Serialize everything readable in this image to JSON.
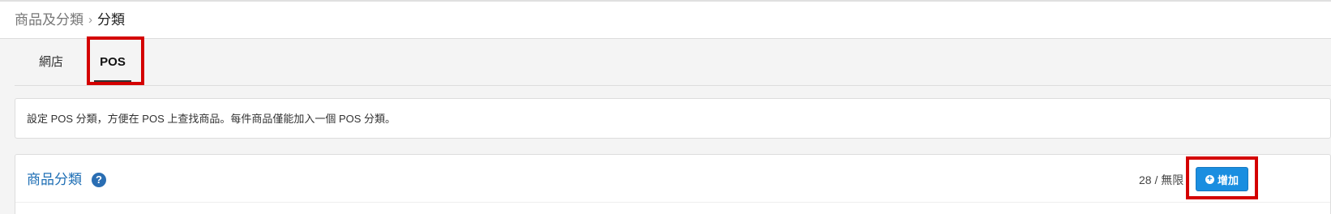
{
  "breadcrumb": {
    "parent": "商品及分類",
    "separator": "›",
    "current": "分類"
  },
  "tabs": [
    {
      "label": "網店",
      "active": false
    },
    {
      "label": "POS",
      "active": true
    }
  ],
  "info": {
    "text": "設定 POS 分類，方便在 POS 上查找商品。每件商品僅能加入一個 POS 分類。"
  },
  "category_panel": {
    "title": "商品分類",
    "help_icon": "question-circle-icon",
    "help_glyph": "?",
    "count": "28 / 無限",
    "add_button": {
      "icon": "plus-circle-icon",
      "glyph": "+",
      "label": "增加"
    }
  },
  "colors": {
    "highlight": "#d40000",
    "accent": "#1a8ee0",
    "title_blue": "#1f6fb5"
  }
}
